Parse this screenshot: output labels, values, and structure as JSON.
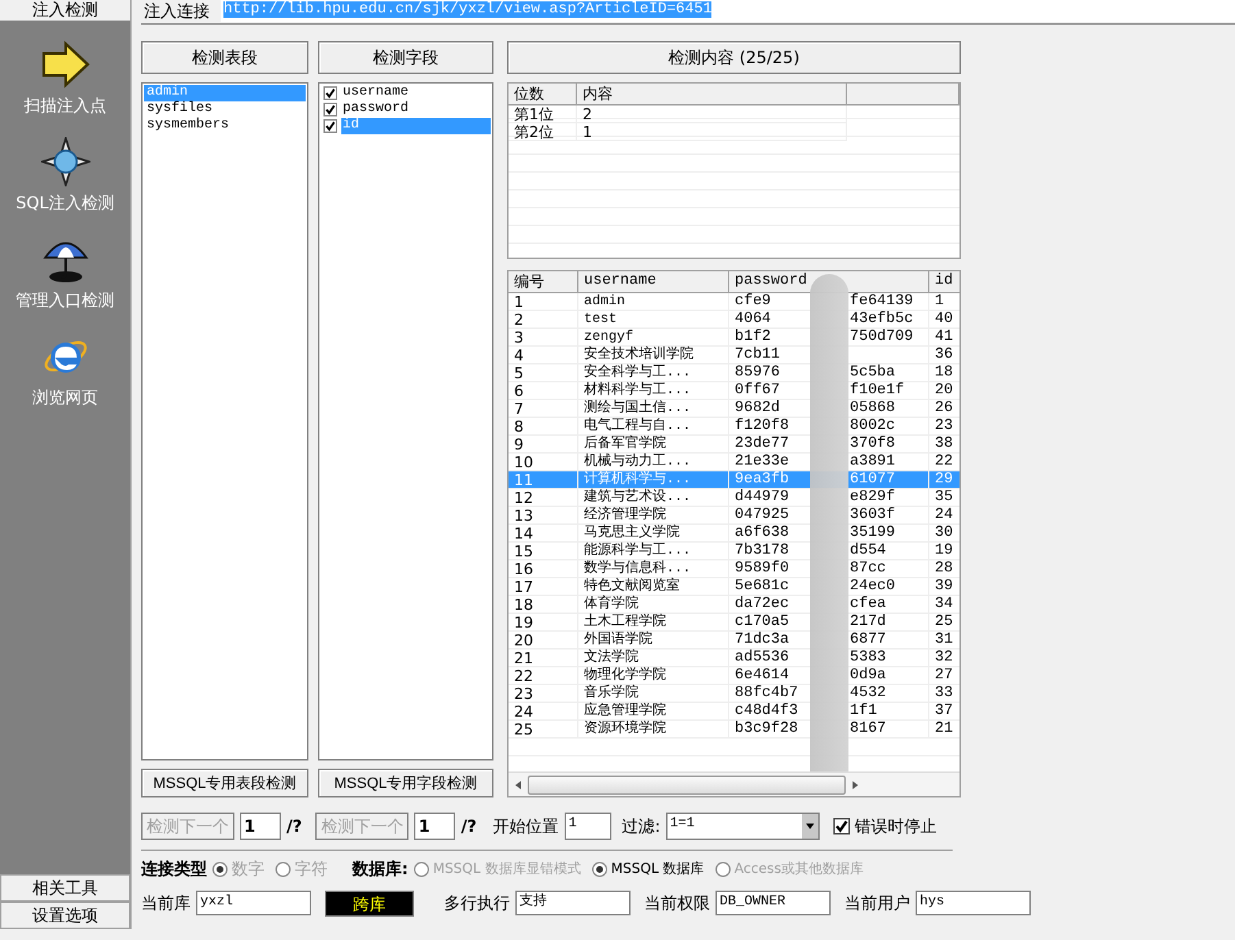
{
  "sidebar": {
    "title": "注入检测",
    "items": [
      {
        "label": "扫描注入点",
        "kind": "arrow"
      },
      {
        "label": "SQL注入检测",
        "kind": "compass"
      },
      {
        "label": "管理入口检测",
        "kind": "umbrella"
      },
      {
        "label": "浏览网页",
        "kind": "browser"
      }
    ],
    "bottom_buttons": [
      "相关工具",
      "设置选项"
    ]
  },
  "url_bar": {
    "label": "注入连接",
    "value": "http://lib.hpu.edu.cn/sjk/yxzl/view.asp?ArticleID=6451"
  },
  "tables_panel": {
    "button": "检测表段",
    "items": [
      {
        "name": "admin",
        "selected": true
      },
      {
        "name": "sysfiles",
        "selected": false
      },
      {
        "name": "sysmembers",
        "selected": false
      }
    ],
    "bottom_button": "MSSQL专用表段检测"
  },
  "fields_panel": {
    "button": "检测字段",
    "items": [
      {
        "name": "username",
        "checked": true,
        "selected": false
      },
      {
        "name": "password",
        "checked": true,
        "selected": false
      },
      {
        "name": "id",
        "checked": true,
        "selected": true
      }
    ],
    "bottom_button": "MSSQL专用字段检测"
  },
  "content_panel": {
    "button": "检测内容 (25/25)",
    "position_table": {
      "columns": [
        "位数",
        "内容"
      ],
      "rows": [
        [
          "第1位",
          "2"
        ],
        [
          "第2位",
          "1"
        ]
      ]
    },
    "data_table": {
      "columns": [
        "编号",
        "username",
        "password",
        "id"
      ],
      "rows": [
        {
          "no": "1",
          "username": "admin",
          "password_shown": [
            "cfe9",
            "fe64139"
          ],
          "id": "1",
          "selected": false
        },
        {
          "no": "2",
          "username": "test",
          "password_shown": [
            "4064",
            "43efb5c"
          ],
          "id": "40",
          "selected": false
        },
        {
          "no": "3",
          "username": "zengyf",
          "password_shown": [
            "b1f2",
            "750d709"
          ],
          "id": "41",
          "selected": false
        },
        {
          "no": "4",
          "username": "安全技术培训学院",
          "password_shown": [
            "7cb11"
          ],
          "id": "36",
          "selected": false
        },
        {
          "no": "5",
          "username": "安全科学与工...",
          "password_shown": [
            "85976",
            "5c5ba"
          ],
          "id": "18",
          "selected": false
        },
        {
          "no": "6",
          "username": "材料科学与工...",
          "password_shown": [
            "0ff67",
            "f10e1f"
          ],
          "id": "20",
          "selected": false
        },
        {
          "no": "7",
          "username": "测绘与国土信...",
          "password_shown": [
            "9682d",
            "05868"
          ],
          "id": "26",
          "selected": false
        },
        {
          "no": "8",
          "username": "电气工程与自...",
          "password_shown": [
            "f120f8",
            "8002c"
          ],
          "id": "23",
          "selected": false
        },
        {
          "no": "9",
          "username": "后备军官学院",
          "password_shown": [
            "23de77",
            "370f8"
          ],
          "id": "38",
          "selected": false
        },
        {
          "no": "10",
          "username": "机械与动力工...",
          "password_shown": [
            "21e33e",
            "a3891"
          ],
          "id": "22",
          "selected": false
        },
        {
          "no": "11",
          "username": "计算机科学与...",
          "password_shown": [
            "9ea3fb",
            "61077"
          ],
          "id": "29",
          "selected": true
        },
        {
          "no": "12",
          "username": "建筑与艺术设...",
          "password_shown": [
            "d44979",
            "e829f"
          ],
          "id": "35",
          "selected": false
        },
        {
          "no": "13",
          "username": "经济管理学院",
          "password_shown": [
            "047925",
            "3603f"
          ],
          "id": "24",
          "selected": false
        },
        {
          "no": "14",
          "username": "马克思主义学院",
          "password_shown": [
            "a6f638",
            "35199"
          ],
          "id": "30",
          "selected": false
        },
        {
          "no": "15",
          "username": "能源科学与工...",
          "password_shown": [
            "7b3178",
            "d554"
          ],
          "id": "19",
          "selected": false
        },
        {
          "no": "16",
          "username": "数学与信息科...",
          "password_shown": [
            "9589f0",
            "87cc"
          ],
          "id": "28",
          "selected": false
        },
        {
          "no": "17",
          "username": "特色文献阅览室",
          "password_shown": [
            "5e681c",
            "24ec0"
          ],
          "id": "39",
          "selected": false
        },
        {
          "no": "18",
          "username": "体育学院",
          "password_shown": [
            "da72ec",
            "cfea"
          ],
          "id": "34",
          "selected": false
        },
        {
          "no": "19",
          "username": "土木工程学院",
          "password_shown": [
            "c170a5",
            "217d"
          ],
          "id": "25",
          "selected": false
        },
        {
          "no": "20",
          "username": "外国语学院",
          "password_shown": [
            "71dc3a",
            "6877"
          ],
          "id": "31",
          "selected": false
        },
        {
          "no": "21",
          "username": "文法学院",
          "password_shown": [
            "ad5536",
            "5383"
          ],
          "id": "32",
          "selected": false
        },
        {
          "no": "22",
          "username": "物理化学学院",
          "password_shown": [
            "6e4614",
            "0d9a"
          ],
          "id": "27",
          "selected": false
        },
        {
          "no": "23",
          "username": "音乐学院",
          "password_shown": [
            "88fc4b7",
            "4532"
          ],
          "id": "33",
          "selected": false
        },
        {
          "no": "24",
          "username": "应急管理学院",
          "password_shown": [
            "c48d4f3",
            "1f1"
          ],
          "id": "37",
          "selected": false
        },
        {
          "no": "25",
          "username": "资源环境学院",
          "password_shown": [
            "b3c9f28",
            "8167"
          ],
          "id": "21",
          "selected": false
        }
      ]
    }
  },
  "controls": {
    "next_table": {
      "button": "检测下一个",
      "disabled": true,
      "value": "1",
      "suffix": "/?"
    },
    "next_field": {
      "button": "检测下一个",
      "disabled": true,
      "value": "1",
      "suffix": "/?"
    },
    "start": {
      "label": "开始位置",
      "value": "1"
    },
    "filter": {
      "label": "过滤:",
      "value": "1=1"
    },
    "stop_on_error": {
      "label": "错误时停止",
      "checked": true
    }
  },
  "connection_type": {
    "label": "连接类型",
    "options": [
      {
        "label": "数字",
        "selected": true,
        "disabled": true
      },
      {
        "label": "字符",
        "selected": false,
        "disabled": true
      }
    ]
  },
  "database": {
    "label": "数据库:",
    "options": [
      {
        "label": "MSSQL 数据库显错模式",
        "selected": false,
        "disabled": true
      },
      {
        "label": "MSSQL 数据库",
        "selected": true,
        "disabled": false
      },
      {
        "label": "Access或其他数据库",
        "selected": false,
        "disabled": true
      }
    ]
  },
  "info": [
    {
      "kind": "field",
      "label": "当前库",
      "value": "yxzl"
    },
    {
      "kind": "button",
      "label": "跨库"
    },
    {
      "kind": "field",
      "label": "多行执行",
      "value": "支持"
    },
    {
      "kind": "field",
      "label": "当前权限",
      "value": "DB_OWNER"
    },
    {
      "kind": "field",
      "label": "当前用户",
      "value": "hys"
    }
  ]
}
